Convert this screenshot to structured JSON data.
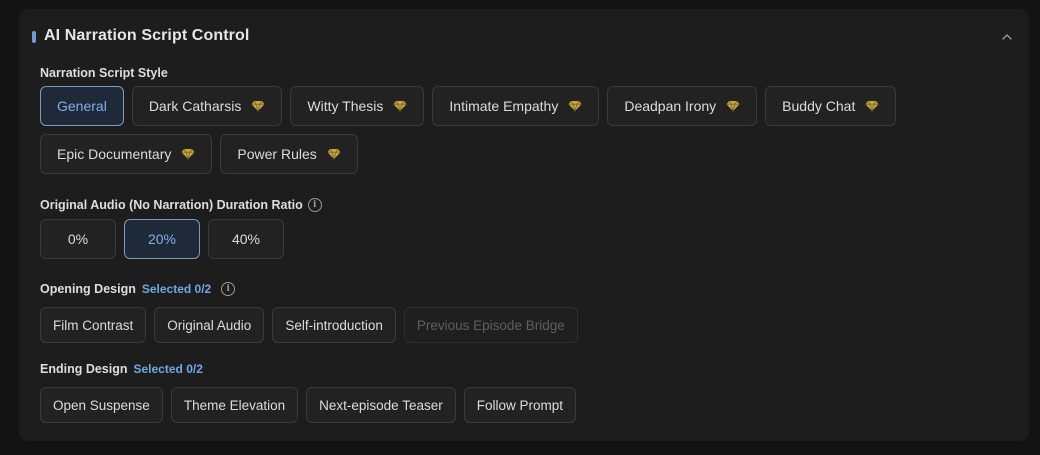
{
  "panel": {
    "title": "AI Narration Script Control"
  },
  "script_style": {
    "label": "Narration Script Style",
    "options": [
      {
        "label": "General",
        "premium": false,
        "selected": true
      },
      {
        "label": "Dark Catharsis",
        "premium": true,
        "selected": false
      },
      {
        "label": "Witty Thesis",
        "premium": true,
        "selected": false
      },
      {
        "label": "Intimate Empathy",
        "premium": true,
        "selected": false
      },
      {
        "label": "Deadpan Irony",
        "premium": true,
        "selected": false
      },
      {
        "label": "Buddy Chat",
        "premium": true,
        "selected": false
      },
      {
        "label": "Epic Documentary",
        "premium": true,
        "selected": false
      },
      {
        "label": "Power Rules",
        "premium": true,
        "selected": false
      }
    ]
  },
  "duration_ratio": {
    "label": "Original Audio (No Narration) Duration Ratio",
    "options": [
      "0%",
      "20%",
      "40%"
    ],
    "selected": "20%"
  },
  "opening": {
    "label": "Opening Design",
    "counter": "Selected 0/2",
    "options": [
      "Film Contrast",
      "Original Audio",
      "Self-introduction",
      "Previous Episode Bridge"
    ],
    "disabled": [
      "Previous Episode Bridge"
    ]
  },
  "ending": {
    "label": "Ending Design",
    "counter": "Selected 0/2",
    "options": [
      "Open Suspense",
      "Theme Elevation",
      "Next-episode Teaser",
      "Follow Prompt"
    ]
  },
  "colors": {
    "accent": "#6fa8e6",
    "premium_gem": "#c9a640",
    "panel_bg": "#1d1d1d"
  },
  "icons": {
    "collapse": "chevron-up-icon",
    "premium": "diamond-icon",
    "info": "info-icon"
  }
}
